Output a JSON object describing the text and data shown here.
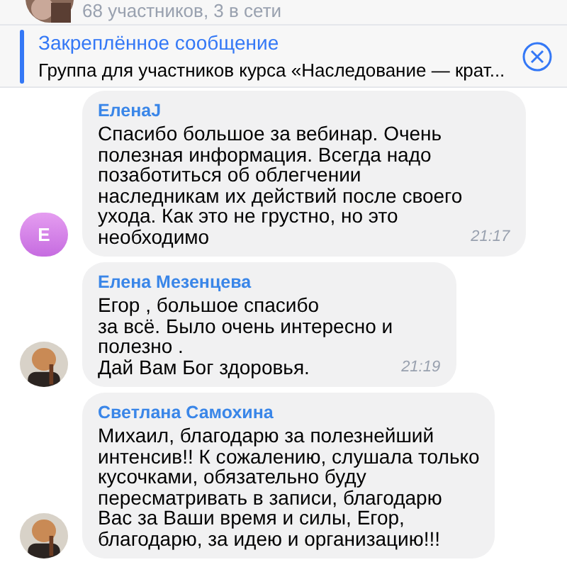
{
  "header": {
    "subtitle": "68 участников, 3 в сети"
  },
  "pinned": {
    "title": "Закреплённое сообщение",
    "text": "Группа для участников курса «Наследование — крат..."
  },
  "messages": [
    {
      "author": "ЕленаJ",
      "text": "Спасибо большое за вебинар. Очень\nполезная информация. Всегда надо\nпозаботиться об облегчении\nнаследникам их действий после своего\nухода. Как это не грустно, но это\nнеобходимо",
      "time": "21:17",
      "avatar": {
        "kind": "letter",
        "letter": "E"
      }
    },
    {
      "author": "Елена Мезенцева",
      "text": "Егор , большое спасибо\nза всё. Было очень интересно и\nполезно .\nДай Вам Бог здоровья.",
      "time": "21:19"
    },
    {
      "author": "Светлана Самохина",
      "text": "Михаил, благодарю за полезнейший\nинтенсив!! К сожалению, слушала только\nкусочками, обязательно буду\nпересматривать в записи, благодарю\nВас за Ваши время и силы, Егор,\nблагодарю, за идею и организацию!!!"
    }
  ]
}
